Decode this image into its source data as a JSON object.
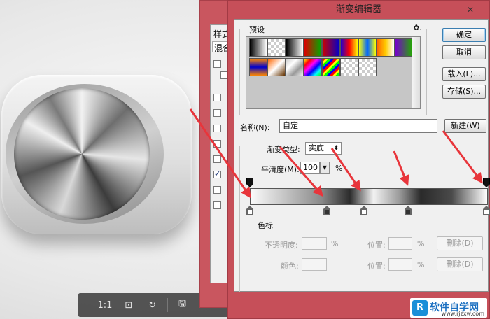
{
  "toolbar": {
    "zoom_label": "1:1",
    "icons": [
      "actual-size-icon",
      "fit-icon",
      "rotate-icon",
      "save-icon",
      "bookmark-icon",
      "crop-icon",
      "share-icon"
    ]
  },
  "layer_style": {
    "title": "样式",
    "blend_label": "混合"
  },
  "gradient_editor": {
    "title": "渐变编辑器",
    "presets_label": "预设",
    "gear_glyph": "✿.",
    "buttons": {
      "ok": "确定",
      "cancel": "取消",
      "load": "载入(L)...",
      "save": "存储(S)...",
      "new": "新建(W)"
    },
    "name_label": "名称(N):",
    "name_value": "自定",
    "gradient_type_label": "渐变类型:",
    "gradient_type_value": "实底",
    "smoothness_label": "平滑度(M):",
    "smoothness_value": "100",
    "percent": "%",
    "stops": {
      "legend": "色标",
      "opacity_label": "不透明度:",
      "location_label": "位置:",
      "color_label": "颜色:",
      "delete_label": "删除(D)"
    }
  },
  "watermark": {
    "logo": "R",
    "text": "软件自学网",
    "url": "www.rjzxw.com"
  },
  "colors": {
    "dialog_frame": "#c64f59",
    "dialog_body": "#f0f0f0",
    "annotation_arrow": "#e8353b"
  }
}
